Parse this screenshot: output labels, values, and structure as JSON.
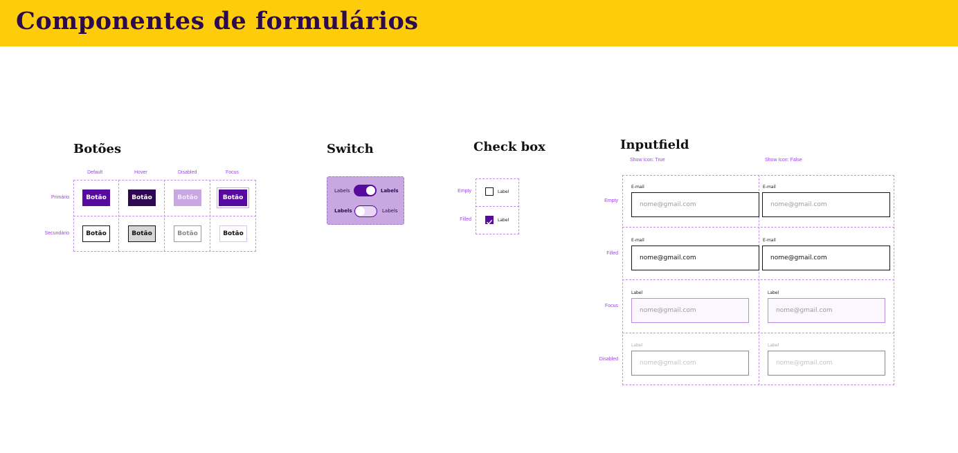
{
  "header": {
    "title": "Componentes de formulários"
  },
  "buttons_section": {
    "title": "Botões",
    "columns": [
      "Default",
      "Hover",
      "Disabled",
      "Focus"
    ],
    "rows": [
      "Primário",
      "Secundário"
    ],
    "button_label": "Botão"
  },
  "switch_section": {
    "title": "Switch",
    "row1": {
      "left": "Labels",
      "right": "Labels",
      "state": "on"
    },
    "row2": {
      "left": "Labels",
      "right": "Labels",
      "state": "off"
    }
  },
  "checkbox_section": {
    "title": "Check box",
    "rows": [
      "Empty",
      "Filled"
    ],
    "label": "Label"
  },
  "input_section": {
    "title": "Inputfield",
    "columns": [
      "Show Icon: True",
      "Show Icon: False"
    ],
    "rows": [
      "Empty",
      "Filled",
      "Focus",
      "Disabled"
    ],
    "email_label": "E-mail",
    "generic_label": "Label",
    "placeholder": "nome@gmail.com",
    "filled_value": "nome@gmail.com"
  },
  "colors": {
    "header_bg": "#fdcd0c",
    "title_text": "#2b0a4e",
    "primary": "#570b9e",
    "primary_hover": "#2e0652",
    "primary_disabled": "#c9a8e2",
    "guide": "#c08ef0",
    "annotation": "#9b45e8",
    "focus_border": "#b98be0"
  }
}
